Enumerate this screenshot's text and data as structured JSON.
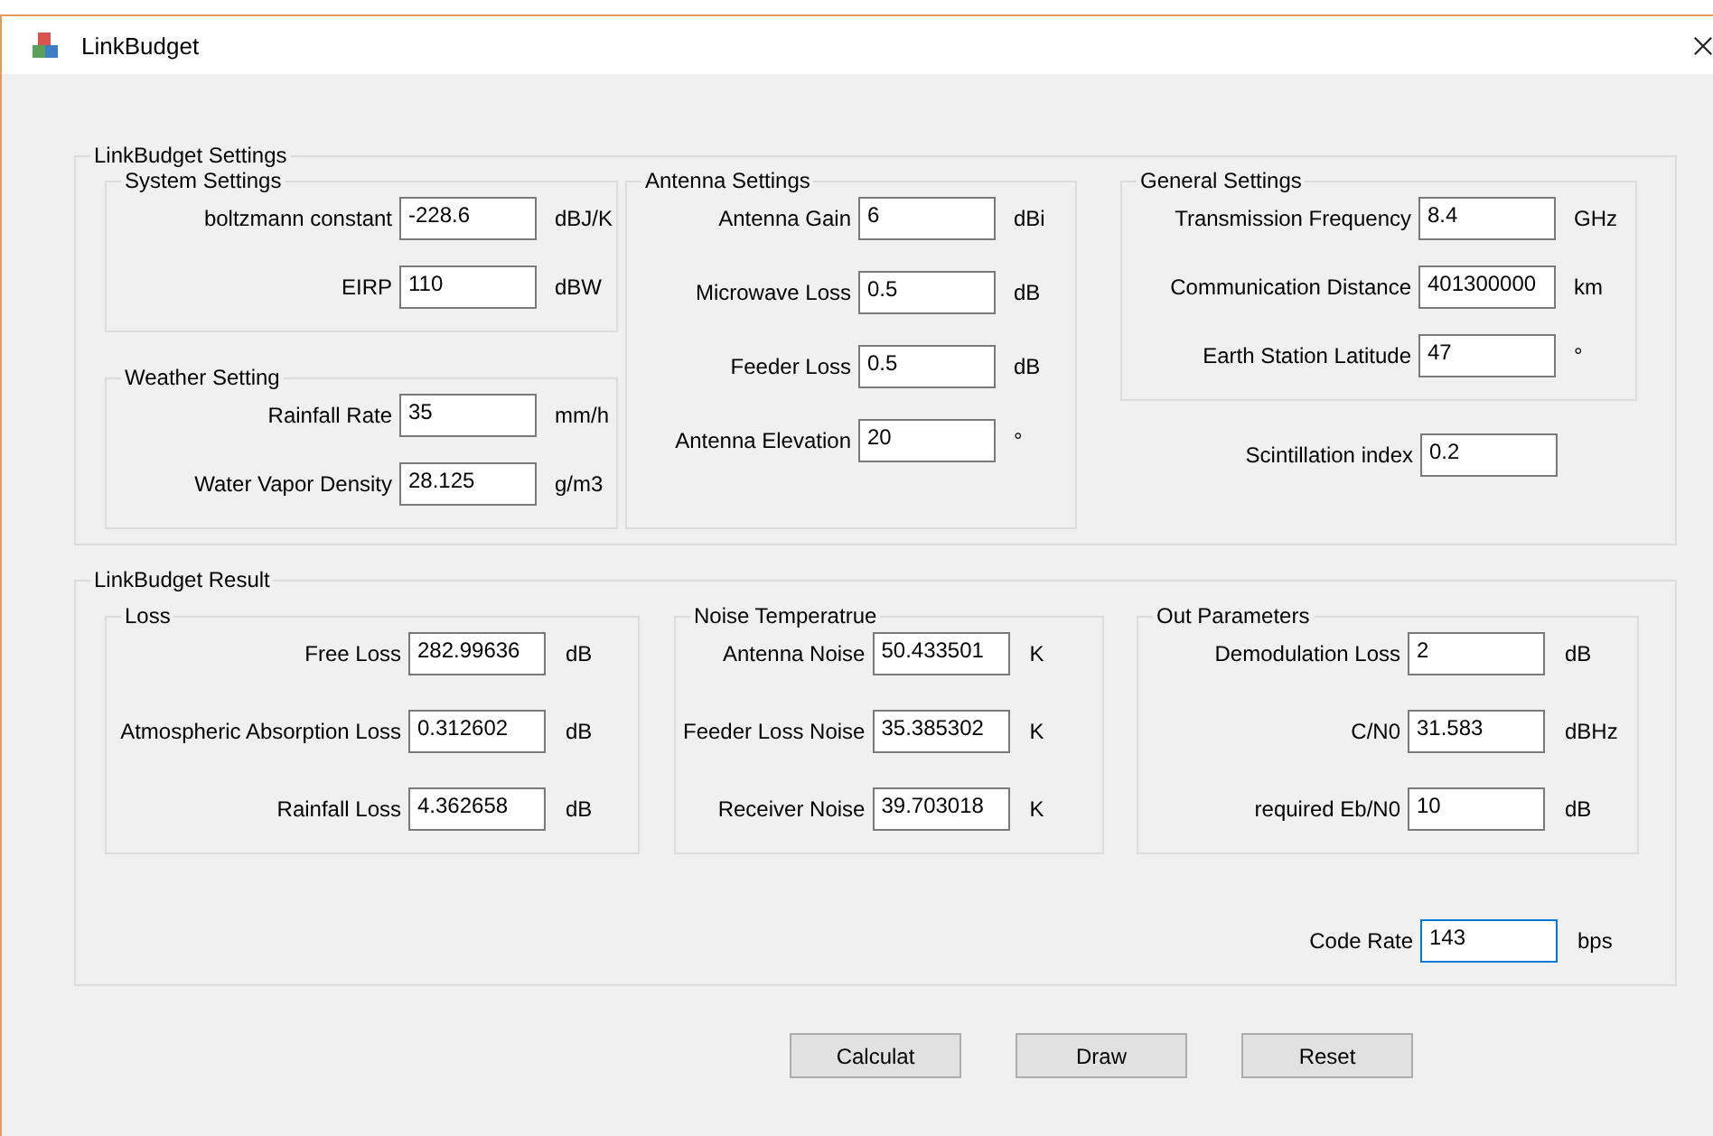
{
  "window": {
    "title": "LinkBudget"
  },
  "sections": [
    {
      "title": "LinkBudget Settings",
      "kind": "settings",
      "columns": [
        {
          "blocks": [
            {
              "kind": "group",
              "title": "System Settings",
              "fields": [
                {
                  "label": "boltzmann constant",
                  "value": "-228.6",
                  "unit": "dBJ/K"
                },
                {
                  "label": "EIRP",
                  "value": "110",
                  "unit": "dBW"
                }
              ]
            },
            {
              "kind": "group",
              "title": "Weather Setting",
              "fields": [
                {
                  "label": "Rainfall Rate",
                  "value": "35",
                  "unit": "mm/h"
                },
                {
                  "label": "Water Vapor Density",
                  "value": "28.125",
                  "unit": "g/m3"
                }
              ]
            }
          ]
        },
        {
          "blocks": [
            {
              "kind": "group",
              "title": "Antenna Settings",
              "fields": [
                {
                  "label": "Antenna Gain",
                  "value": "6",
                  "unit": "dBi"
                },
                {
                  "label": "Microwave Loss",
                  "value": "0.5",
                  "unit": "dB"
                },
                {
                  "label": "Feeder Loss",
                  "value": "0.5",
                  "unit": "dB"
                },
                {
                  "label": "Antenna Elevation",
                  "value": "20",
                  "unit": "°"
                }
              ]
            }
          ]
        },
        {
          "blocks": [
            {
              "kind": "group",
              "title": "General  Settings",
              "fields": [
                {
                  "label": "Transmission Frequency",
                  "value": "8.4",
                  "unit": "GHz"
                },
                {
                  "label": "Communication Distance",
                  "value": "401300000",
                  "unit": "km"
                },
                {
                  "label": "Earth Station Latitude",
                  "value": "47",
                  "unit": "°"
                }
              ]
            },
            {
              "kind": "field",
              "label": "Scintillation index",
              "value": "0.2",
              "focused": false
            }
          ]
        }
      ]
    },
    {
      "title": "LinkBudget Result",
      "kind": "result",
      "columns": [
        {
          "blocks": [
            {
              "kind": "group",
              "title": "Loss",
              "fields": [
                {
                  "label": "Free Loss",
                  "value": "282.99636",
                  "unit": "dB"
                },
                {
                  "label": "Atmospheric Absorption Loss",
                  "value": "0.312602",
                  "unit": "dB"
                },
                {
                  "label": "Rainfall Loss",
                  "value": "4.362658",
                  "unit": "dB"
                }
              ]
            }
          ]
        },
        {
          "blocks": [
            {
              "kind": "group",
              "title": "Noise Temperatrue",
              "fields": [
                {
                  "label": "Antenna Noise",
                  "value": "50.433501",
                  "unit": "K"
                },
                {
                  "label": "Feeder Loss Noise",
                  "value": "35.385302",
                  "unit": "K"
                },
                {
                  "label": "Receiver Noise",
                  "value": "39.703018",
                  "unit": "K"
                }
              ]
            }
          ]
        },
        {
          "blocks": [
            {
              "kind": "group",
              "title": "Out Parameters",
              "fields": [
                {
                  "label": "Demodulation Loss",
                  "value": "2",
                  "unit": "dB"
                },
                {
                  "label": "C/N0",
                  "value": "31.583",
                  "unit": "dBHz"
                },
                {
                  "label": "required Eb/N0",
                  "value": "10",
                  "unit": "dB"
                }
              ]
            },
            {
              "kind": "field",
              "label": "Code Rate",
              "value": "143",
              "unit": "bps",
              "focused": true
            }
          ]
        }
      ]
    }
  ],
  "buttons": [
    "Calculat",
    "Draw",
    "Reset"
  ]
}
